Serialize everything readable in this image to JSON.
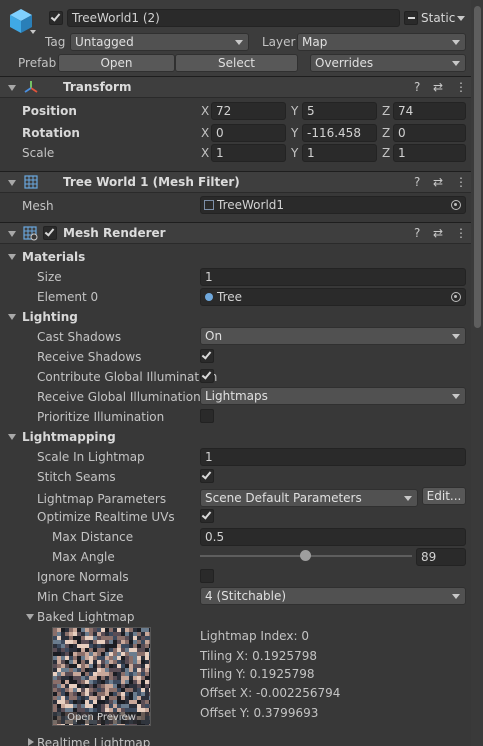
{
  "object": {
    "name": "TreeWorld1 (2)",
    "static_label": "Static",
    "tag_label": "Tag",
    "tag_value": "Untagged",
    "layer_label": "Layer",
    "layer_value": "Map",
    "prefab_label": "Prefab",
    "prefab_open": "Open",
    "prefab_select": "Select",
    "prefab_overrides": "Overrides"
  },
  "transform": {
    "title": "Transform",
    "position_label": "Position",
    "rotation_label": "Rotation",
    "scale_label": "Scale",
    "axes": {
      "x": "X",
      "y": "Y",
      "z": "Z"
    },
    "position": {
      "x": "72",
      "y": "5",
      "z": "74"
    },
    "rotation": {
      "x": "0",
      "y": "-116.458",
      "z": "0"
    },
    "scale": {
      "x": "1",
      "y": "1",
      "z": "1"
    }
  },
  "mesh_filter": {
    "title": "Tree World 1 (Mesh Filter)",
    "mesh_label": "Mesh",
    "mesh_value": "TreeWorld1"
  },
  "mesh_renderer": {
    "title": "Mesh Renderer",
    "materials": {
      "section": "Materials",
      "size_label": "Size",
      "size_value": "1",
      "element0_label": "Element 0",
      "element0_value": "Tree"
    },
    "lighting": {
      "section": "Lighting",
      "cast_shadows_label": "Cast Shadows",
      "cast_shadows_value": "On",
      "receive_shadows_label": "Receive Shadows",
      "contribute_gi_label": "Contribute Global Illumination",
      "receive_gi_label": "Receive Global Illumination",
      "receive_gi_value": "Lightmaps",
      "prioritize_label": "Prioritize Illumination"
    },
    "lightmapping": {
      "section": "Lightmapping",
      "scale_label": "Scale In Lightmap",
      "scale_value": "1",
      "stitch_label": "Stitch Seams",
      "params_label": "Lightmap Parameters",
      "params_value": "Scene Default Parameters",
      "edit_button": "Edit...",
      "optimize_label": "Optimize Realtime UVs",
      "max_distance_label": "Max Distance",
      "max_distance_value": "0.5",
      "max_angle_label": "Max Angle",
      "max_angle_value": "89",
      "max_angle_fraction": 0.494,
      "ignore_normals_label": "Ignore Normals",
      "min_chart_label": "Min Chart Size",
      "min_chart_value": "4 (Stitchable)",
      "baked_label": "Baked Lightmap",
      "open_preview": "Open Preview",
      "lightmap_index": "Lightmap Index: 0",
      "tiling_x": "Tiling X: 0.1925798",
      "tiling_y": "Tiling Y: 0.1925798",
      "offset_x": "Offset X: -0.002256794",
      "offset_y": "Offset Y: 0.3799693",
      "realtime_label": "Realtime Lightmap"
    }
  },
  "colors": {
    "background": "#383838",
    "field": "#2a2a2a",
    "dropdown": "#515151",
    "cube_icon": "#3fa9e6",
    "transform_icon": "#e0a040"
  }
}
